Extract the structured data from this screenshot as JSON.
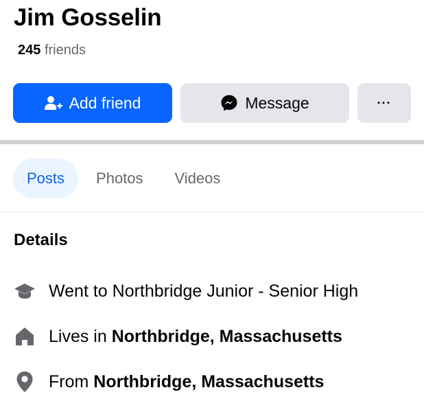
{
  "profile": {
    "name": "Jim Gosselin",
    "friends_count": "245",
    "friends_label": "friends"
  },
  "actions": {
    "add_friend_label": "Add friend",
    "message_label": "Message",
    "more_label": "···"
  },
  "tabs": [
    {
      "label": "Posts",
      "active": true
    },
    {
      "label": "Photos",
      "active": false
    },
    {
      "label": "Videos",
      "active": false
    }
  ],
  "details": {
    "title": "Details",
    "items": [
      {
        "icon": "graduation-cap-icon",
        "prefix": "Went to Northbridge Junior - Senior High",
        "bold": ""
      },
      {
        "icon": "home-icon",
        "prefix": "Lives in ",
        "bold": "Northbridge, Massachusetts"
      },
      {
        "icon": "location-pin-icon",
        "prefix": "From ",
        "bold": "Northbridge, Massachusetts"
      }
    ]
  },
  "colors": {
    "primary": "#0866ff",
    "secondary_button": "#e4e6eb",
    "active_tab_bg": "#ebf5ff",
    "active_tab_text": "#0a66d8",
    "muted_text": "#65676b",
    "icon_gray": "#65676b"
  }
}
